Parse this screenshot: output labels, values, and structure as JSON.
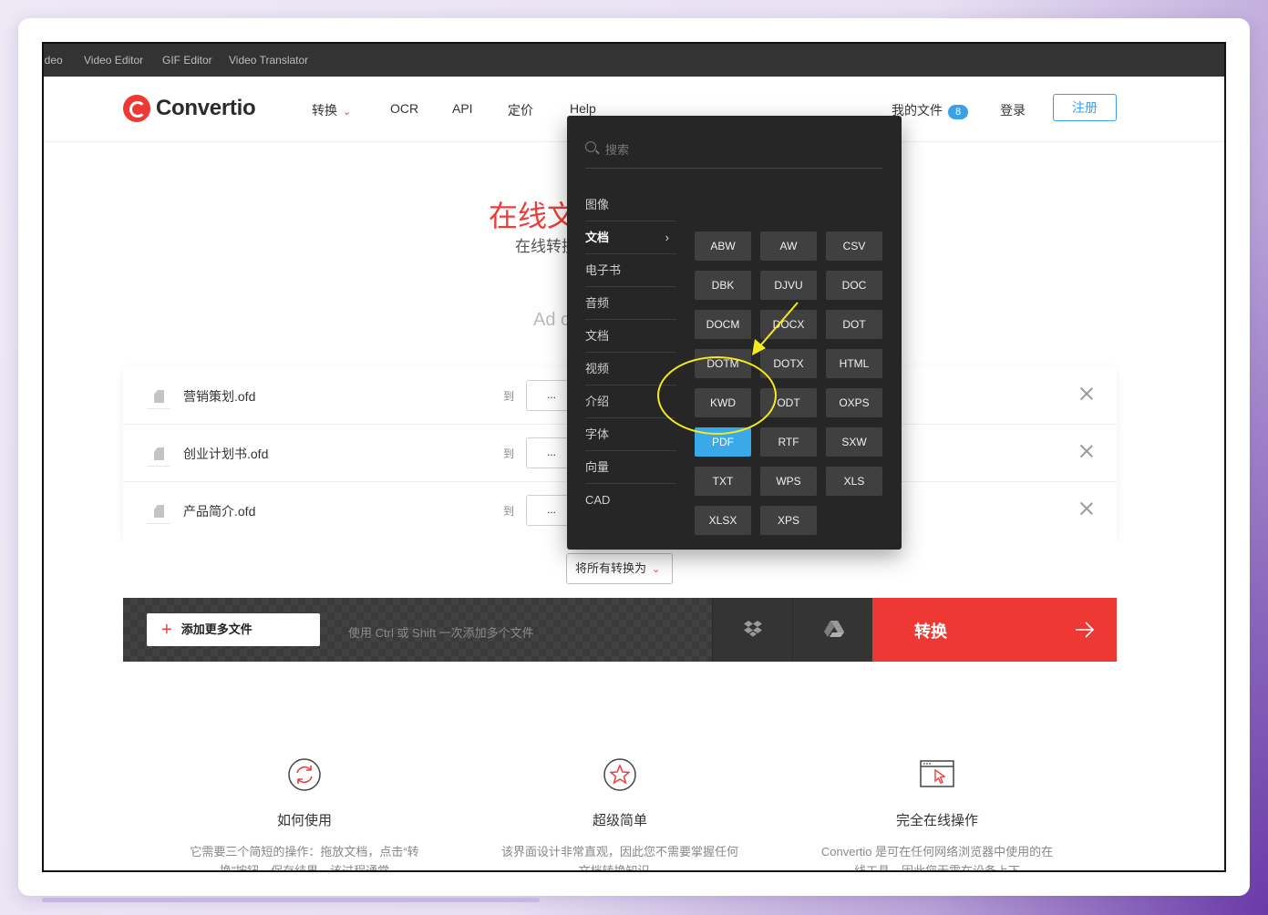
{
  "topbar": {
    "items": [
      "ideo",
      "Video Editor",
      "GIF Editor",
      "Video Translator"
    ]
  },
  "header": {
    "logo_text": "Convertio",
    "nav": {
      "convert": "转换",
      "ocr": "OCR",
      "api": "API",
      "pricing": "定价",
      "help": "Help"
    },
    "my_files": "我的文件",
    "files_count": "8",
    "login": "登录",
    "signup": "注册"
  },
  "hero": {
    "title": "在线文",
    "subtitle": "在线转换",
    "ad": "Ad c"
  },
  "files": [
    {
      "name": "营销策划.ofd",
      "to": "到",
      "select": "..."
    },
    {
      "name": "创业计划书.ofd",
      "to": "到",
      "select": "..."
    },
    {
      "name": "产品简介.ofd",
      "to": "到",
      "select": "..."
    }
  ],
  "convert_all": "将所有转换为",
  "actionbar": {
    "add_more": "添加更多文件",
    "hint": "使用 Ctrl 或 Shift 一次添加多个文件",
    "convert": "转换"
  },
  "features": [
    {
      "title": "如何使用",
      "desc": "它需要三个简短的操作：拖放文档，点击“转换”按钮，保存结果。该过程通常"
    },
    {
      "title": "超级简单",
      "desc": "该界面设计非常直观，因此您不需要掌握任何文档转换知识。"
    },
    {
      "title": "完全在线操作",
      "desc": "Convertio 是可在任何网络浏览器中使用的在线工具，因此您无需在设备上下"
    }
  ],
  "dropdown": {
    "search_placeholder": "搜索",
    "categories": [
      "图像",
      "文档",
      "电子书",
      "音频",
      "文档",
      "视频",
      "介绍",
      "字体",
      "向量",
      "CAD"
    ],
    "active_category": "文档",
    "formats": [
      "ABW",
      "AW",
      "CSV",
      "DBK",
      "DJVU",
      "DOC",
      "DOCM",
      "DOCX",
      "DOT",
      "DOTM",
      "DOTX",
      "HTML",
      "KWD",
      "ODT",
      "OXPS",
      "PDF",
      "RTF",
      "SXW",
      "TXT",
      "WPS",
      "XLS",
      "XLSX",
      "XPS"
    ],
    "selected_format": "PDF"
  },
  "colors": {
    "brand_red": "#ee3833",
    "accent_blue": "#3aa0e8",
    "annotation_yellow": "#f4eb1c"
  }
}
